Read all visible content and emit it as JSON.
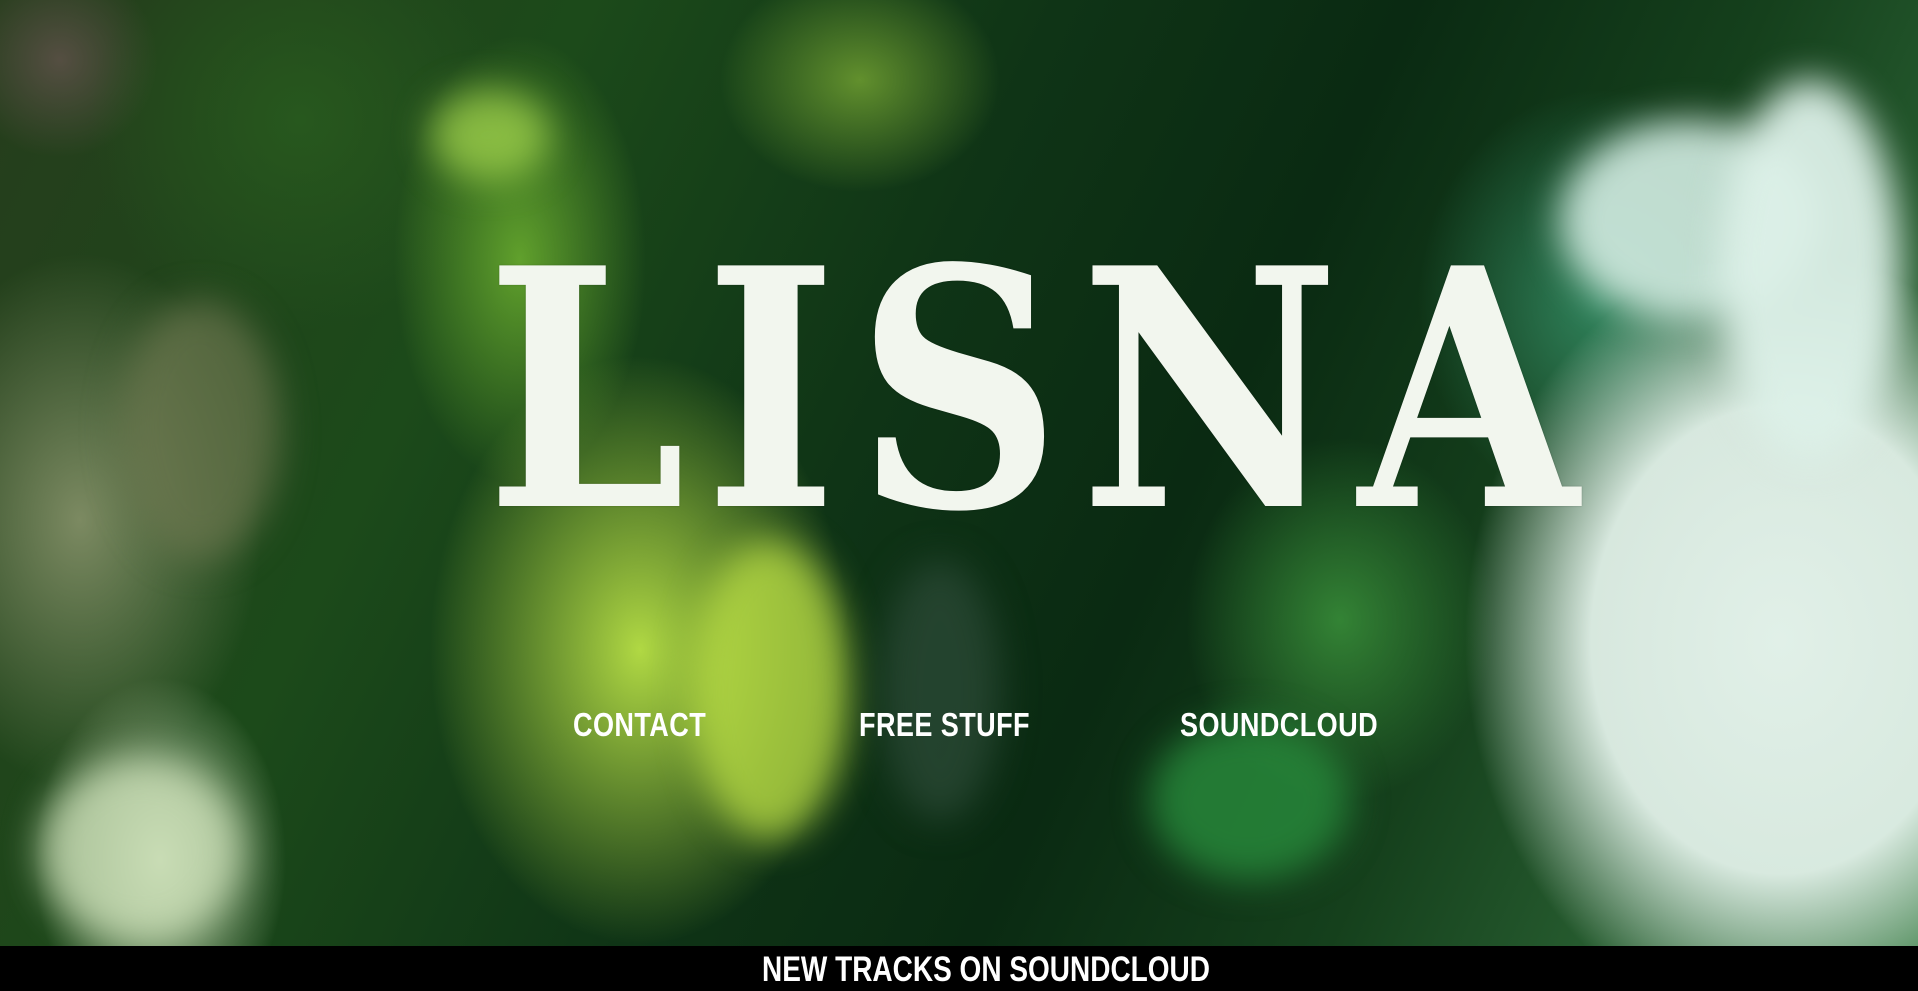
{
  "brand": {
    "logo_text": "LISNA"
  },
  "nav": {
    "items": [
      {
        "label": "CONTACT"
      },
      {
        "label": "FREE STUFF"
      },
      {
        "label": "SOUNDCLOUD"
      }
    ]
  },
  "footer_banner": {
    "label": "NEW TRACKS ON SOUNDCLOUD"
  },
  "colors": {
    "text": "#ffffff",
    "banner_bg": "#000000",
    "background_dominant": "#0f3416"
  }
}
